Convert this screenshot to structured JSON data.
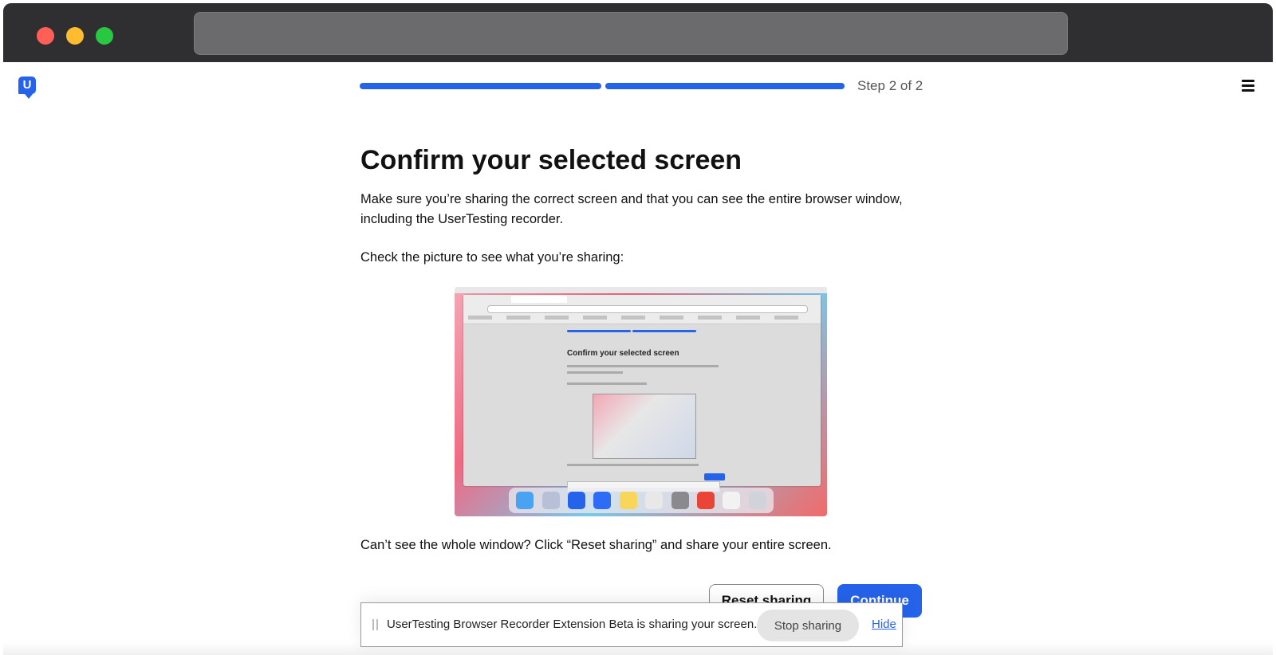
{
  "window": {
    "url_value": ""
  },
  "header": {
    "logo_letter": "U",
    "step_text": "Step 2 of 2",
    "progress": {
      "completed_steps": 2,
      "total_steps": 2
    }
  },
  "main": {
    "title": "Confirm your selected screen",
    "description": "Make sure you’re sharing the correct screen and that you can see the entire browser window, including the UserTesting recorder.",
    "check_text": "Check the picture to see what you’re sharing:",
    "preview": {
      "title": "Confirm your selected screen"
    },
    "cant_see_text": "Can’t see the whole window? Click “Reset sharing” and share your entire screen.",
    "reset_label": "Reset sharing",
    "continue_label": "Continue"
  },
  "share_bar": {
    "message": "UserTesting Browser Recorder Extension Beta is sharing your screen.",
    "stop_label": "Stop sharing",
    "hide_label": "Hide"
  },
  "colors": {
    "accent": "#2563eb",
    "traffic_red": "#ff5f57",
    "traffic_yellow": "#febc2e",
    "traffic_green": "#28c840"
  }
}
